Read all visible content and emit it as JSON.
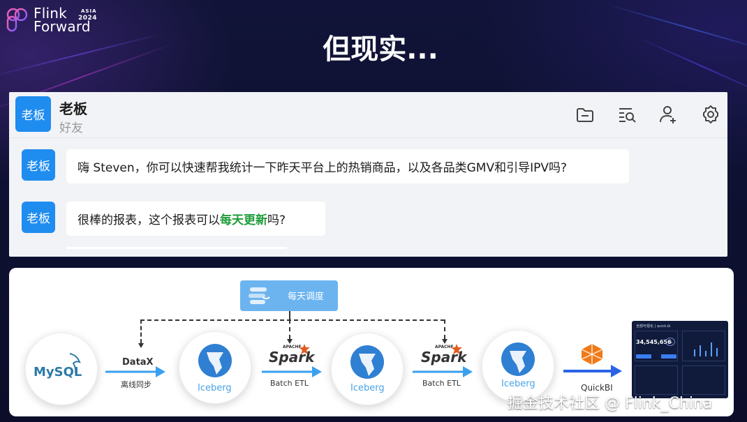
{
  "logo": {
    "word1": "Flink",
    "word2": "Forward",
    "region": "ASIA",
    "year": "2024"
  },
  "slide": {
    "title": "但现实..."
  },
  "chat": {
    "contact_name": "老板",
    "contact_subtitle": "好友",
    "avatar_text": "老板",
    "header_icons": [
      "folder-icon",
      "search-list-icon",
      "add-user-icon",
      "settings-gear-icon"
    ],
    "messages": [
      {
        "sender_avatar": "老板",
        "text": "嗨 Steven，你可以快速帮我统计一下昨天平台上的热销商品，以及各品类GMV和引导IPV吗?"
      },
      {
        "sender_avatar": "老板",
        "text_before": "很棒的报表，这个报表可以",
        "highlight": "每天更新",
        "text_after": "吗?"
      }
    ]
  },
  "diagram": {
    "scheduler": {
      "label": "每天调度"
    },
    "nodes": [
      {
        "label": "MySQL"
      },
      {
        "label": "Iceberg"
      },
      {
        "label": "Iceberg"
      },
      {
        "label": "Iceberg"
      }
    ],
    "edges": [
      {
        "top": "DataX",
        "bottom": "离线同步"
      },
      {
        "logo_small": "APACHE",
        "logo": "Spark",
        "bottom": "Batch ETL"
      },
      {
        "logo_small": "APACHE",
        "logo": "Spark",
        "bottom": "Batch ETL"
      },
      {
        "bottom": "QuickBI"
      }
    ],
    "dashboard": {
      "header": "全部可视化 | quick.bi",
      "value": "34,545,656",
      "chip": "1%"
    }
  },
  "watermark": "掘金技术社区 @ Flink_China",
  "colors": {
    "accent_blue": "#1f8cf0",
    "highlight_green": "#1f9d3a",
    "background": "#0c0f2e"
  }
}
